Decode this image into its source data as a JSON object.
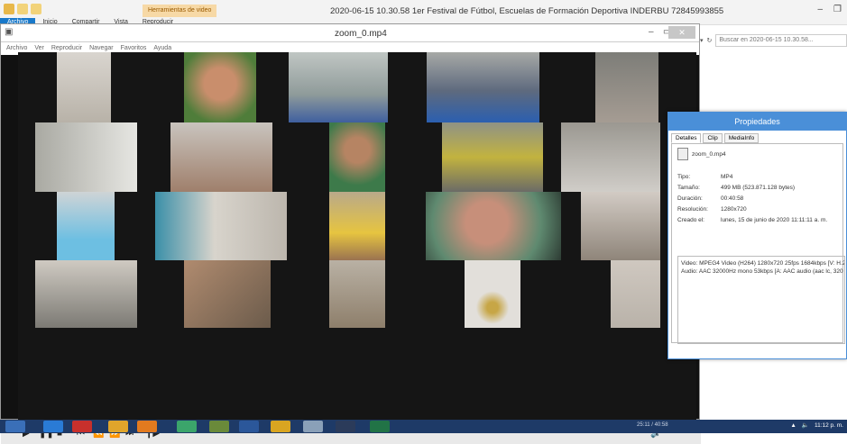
{
  "explorer": {
    "tools_tab": "Herramientas de video",
    "title": "2020-06-15 10.30.58 1er Festival de Fútbol, Escuelas de Formación Deportiva INDERBU 72845993855",
    "ribbon_tabs": [
      "Archivo",
      "Inicio",
      "Compartir",
      "Vista",
      "Reproducir"
    ],
    "search_placeholder": "Buscar en 2020-06-15 10.30.58..."
  },
  "player": {
    "title": "zoom_0.mp4",
    "menu": [
      "Archivo",
      "Ver",
      "Reproducir",
      "Navegar",
      "Favoritos",
      "Ayuda"
    ]
  },
  "properties": {
    "title": "Propiedades",
    "tabs": [
      "Detalles",
      "Clip",
      "MediaInfo"
    ],
    "filename": "zoom_0.mp4",
    "rows": [
      {
        "key": "Tipo:",
        "value": "MP4"
      },
      {
        "key": "Tamaño:",
        "value": "499 MB (523.871.128 bytes)"
      },
      {
        "key": "Duración:",
        "value": "00:40:58"
      },
      {
        "key": "Resolución:",
        "value": "1280x720"
      },
      {
        "key": "Creado el:",
        "value": "lunes, 15 de junio de 2020 11:11:11 a. m."
      }
    ],
    "stream_video": "Video: MPEG4 Video (H264) 1280x720 25fps 1684kbps [V: H.2",
    "stream_audio": "Audio: AAC 32000Hz mono 53kbps [A: AAC audio (aac lc, 320"
  },
  "taskbar": {
    "time": "11:12 p. m.",
    "player_time": "25:11 / 40:58"
  }
}
